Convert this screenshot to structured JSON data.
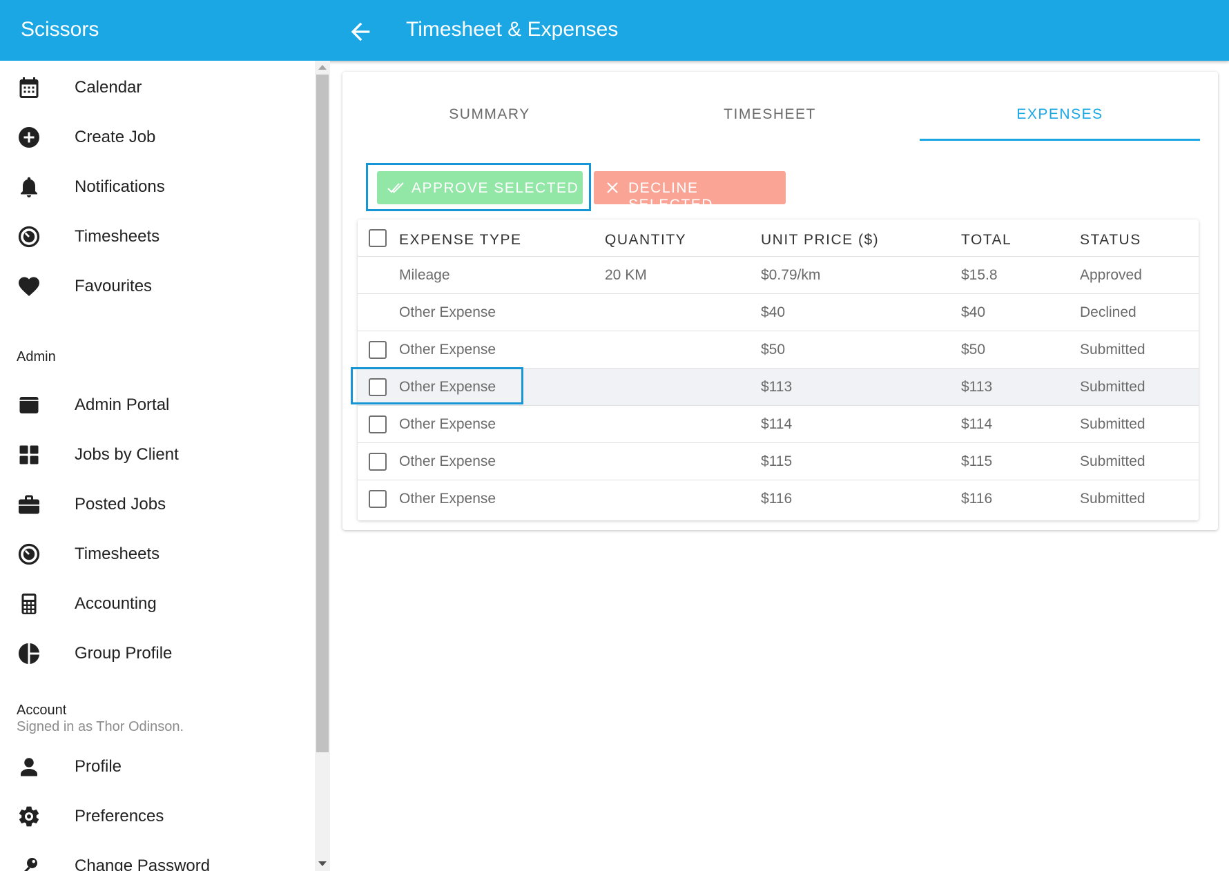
{
  "app": {
    "name": "Scissors",
    "page_title": "Timesheet & Expenses"
  },
  "sidebar": {
    "items": [
      {
        "label": "Calendar",
        "icon": "calendar-icon"
      },
      {
        "label": "Create Job",
        "icon": "plus-circle-icon"
      },
      {
        "label": "Notifications",
        "icon": "bell-icon"
      },
      {
        "label": "Timesheets",
        "icon": "timer-icon"
      },
      {
        "label": "Favourites",
        "icon": "heart-icon"
      }
    ],
    "admin_title": "Admin",
    "admin_items": [
      {
        "label": "Admin Portal",
        "icon": "window-icon"
      },
      {
        "label": "Jobs by Client",
        "icon": "grid-icon"
      },
      {
        "label": "Posted Jobs",
        "icon": "briefcase-icon"
      },
      {
        "label": "Timesheets",
        "icon": "timer-icon"
      },
      {
        "label": "Accounting",
        "icon": "calculator-icon"
      },
      {
        "label": "Group Profile",
        "icon": "pie-chart-icon"
      }
    ],
    "account_title": "Account",
    "account_subtitle": "Signed in as Thor Odinson.",
    "account_items": [
      {
        "label": "Profile",
        "icon": "person-icon"
      },
      {
        "label": "Preferences",
        "icon": "gear-icon"
      },
      {
        "label": "Change Password",
        "icon": "key-icon"
      }
    ]
  },
  "tabs": [
    {
      "label": "SUMMARY",
      "active": false
    },
    {
      "label": "TIMESHEET",
      "active": false
    },
    {
      "label": "EXPENSES",
      "active": true
    }
  ],
  "actions": {
    "approve_label": "APPROVE SELECTED",
    "decline_label": "DECLINE SELECTED"
  },
  "table": {
    "headers": {
      "type": "EXPENSE TYPE",
      "quantity": "QUANTITY",
      "unit_price": "UNIT PRICE ($)",
      "total": "TOTAL",
      "status": "STATUS"
    },
    "rows": [
      {
        "type": "Mileage",
        "quantity": "20 KM",
        "unit_price": "$0.79/km",
        "total": "$15.8",
        "status": "Approved",
        "selectable": false,
        "checked": false
      },
      {
        "type": "Other Expense",
        "quantity": "",
        "unit_price": "$40",
        "total": "$40",
        "status": "Declined",
        "selectable": false,
        "checked": false
      },
      {
        "type": "Other Expense",
        "quantity": "",
        "unit_price": "$50",
        "total": "$50",
        "status": "Submitted",
        "selectable": true,
        "checked": false
      },
      {
        "type": "Other Expense",
        "quantity": "",
        "unit_price": "$113",
        "total": "$113",
        "status": "Submitted",
        "selectable": true,
        "checked": false
      },
      {
        "type": "Other Expense",
        "quantity": "",
        "unit_price": "$114",
        "total": "$114",
        "status": "Submitted",
        "selectable": true,
        "checked": false
      },
      {
        "type": "Other Expense",
        "quantity": "",
        "unit_price": "$115",
        "total": "$115",
        "status": "Submitted",
        "selectable": true,
        "checked": false
      },
      {
        "type": "Other Expense",
        "quantity": "",
        "unit_price": "$116",
        "total": "$116",
        "status": "Submitted",
        "selectable": true,
        "checked": false
      }
    ]
  },
  "colors": {
    "primary": "#1aa7e4",
    "approve": "#92e6a6",
    "decline": "#f9a494",
    "focus_outline": "#1696d4"
  }
}
